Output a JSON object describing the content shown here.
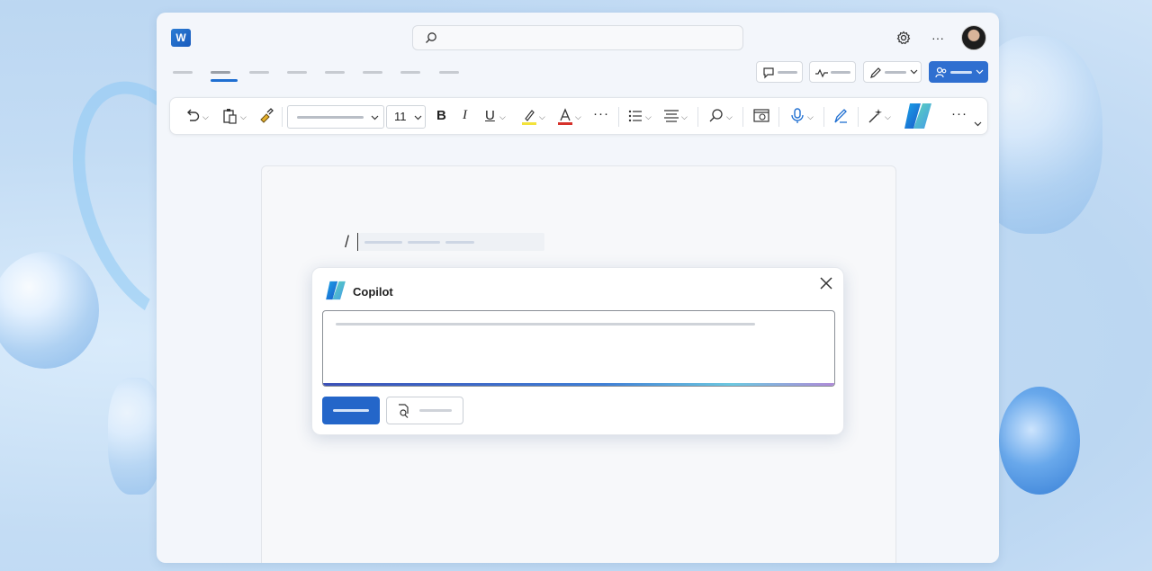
{
  "app": {
    "logo_letter": "W",
    "accent": "#1f6fd1"
  },
  "titlebar": {
    "search_icon": "search-icon",
    "settings_icon": "gear-icon",
    "more_icon": "more-icon",
    "more_glyph": "···"
  },
  "toolbar": {
    "font_size": "11",
    "bold": "B",
    "italic": "I",
    "underline": "U",
    "more_glyph": "···"
  },
  "document": {
    "slash_command": "/"
  },
  "copilot": {
    "title": "Copilot"
  }
}
